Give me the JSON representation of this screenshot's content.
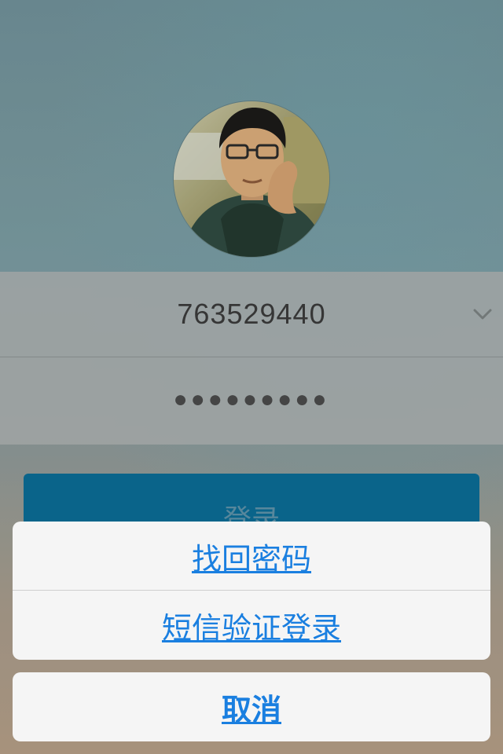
{
  "login": {
    "account": "763529440",
    "password_mask": "●●●●●●●●●",
    "login_button_label": "登录"
  },
  "action_sheet": {
    "items": [
      {
        "label": "找回密码"
      },
      {
        "label": "短信验证登录"
      }
    ],
    "cancel_label": "取消"
  },
  "colors": {
    "accent": "#1a7fe0",
    "login_button": "#0b6b93"
  },
  "icons": {
    "dropdown": "chevron-down-icon",
    "avatar": "user-avatar-photo"
  }
}
